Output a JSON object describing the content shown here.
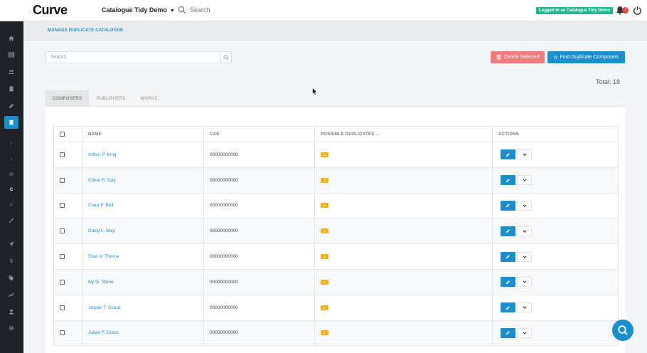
{
  "app": {
    "logo": "Curve",
    "catalogue": "Catalogue Tidy Demo"
  },
  "header": {
    "search_label": "Search",
    "logged_in": "Logged in as Catalogue Tidy Demo",
    "notification_count": "1"
  },
  "sidebar": {
    "items": [
      {
        "icon": "home-icon"
      },
      {
        "icon": "table-icon"
      },
      {
        "icon": "users-icon"
      },
      {
        "icon": "document-icon"
      },
      {
        "icon": "pencil-icon"
      },
      {
        "icon": "book-icon",
        "active": true
      },
      {
        "letter": "r"
      },
      {
        "letter": "I"
      },
      {
        "letter": "W"
      },
      {
        "letter": "C",
        "current": true
      },
      {
        "letter": "P"
      },
      {
        "icon": "wand-icon"
      },
      {
        "icon": "send-icon"
      },
      {
        "icon": "dollar-icon"
      },
      {
        "icon": "tag-icon"
      },
      {
        "icon": "chart-icon"
      },
      {
        "icon": "account-icon"
      },
      {
        "icon": "settings-icon"
      }
    ]
  },
  "subheader": {
    "title": "MANAGE DUPLICATE CATALOGUE"
  },
  "toolbar": {
    "search_placeholder": "Search",
    "delete_label": "Delete Selected",
    "find_label": "Find Duplicate Composers"
  },
  "total": "Total: 18",
  "tabs": [
    {
      "label": "COMPOSERS",
      "active": true
    },
    {
      "label": "PUBLISHERS"
    },
    {
      "label": "WORKS"
    }
  ],
  "table": {
    "headers": {
      "name": "NAME",
      "cae": "CAE",
      "dups": "POSSIBLE DUPLICATES",
      "actions": "ACTIONS"
    },
    "rows": [
      {
        "name": "Arthur P. King",
        "cae": "00000000000",
        "dups": "1"
      },
      {
        "name": "Chloe R. Day",
        "cae": "00000000000",
        "dups": "1"
      },
      {
        "name": "Clara P. Bell",
        "cae": "00000000000",
        "dups": "1"
      },
      {
        "name": "Daisy L. May",
        "cae": "00000000000",
        "dups": "1"
      },
      {
        "name": "Elias V. Thorne",
        "cae": "00000000000",
        "dups": "1"
      },
      {
        "name": "Ivy G. Stone",
        "cae": "00000000000",
        "dups": "1"
      },
      {
        "name": "Jasper T. Cloud",
        "cae": "00000000000",
        "dups": "1"
      },
      {
        "name": "Julian F. Cross",
        "cae": "00000000000",
        "dups": "1"
      }
    ]
  },
  "colors": {
    "primary": "#1b8fcb",
    "danger": "#f07d7d",
    "badge": "#f1b21b",
    "sidebar": "#1f2327",
    "success": "#1fb68f"
  }
}
